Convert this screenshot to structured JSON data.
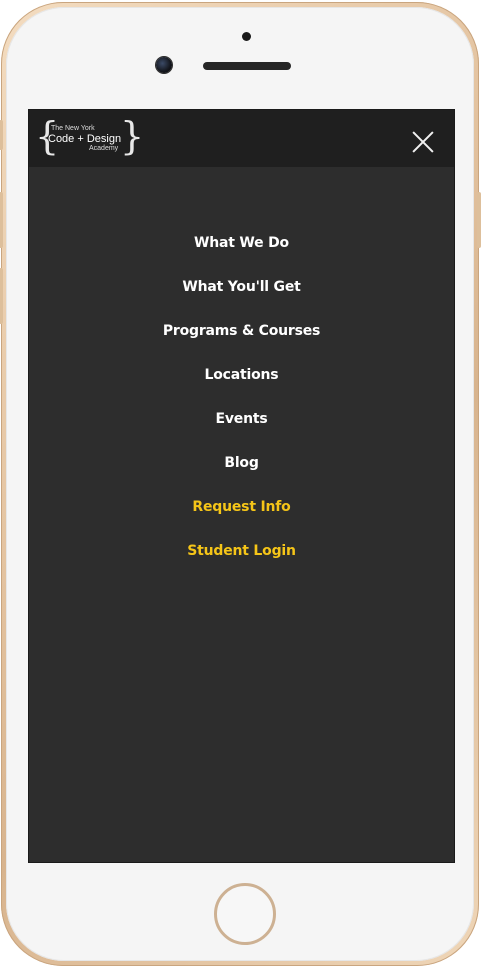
{
  "device": {
    "frame_color": "#e3c3a0",
    "body_color": "#f5f5f5"
  },
  "header": {
    "background": "#1f1f1f",
    "logo": {
      "line1": "The New York",
      "line2": "Code + Design",
      "line3": "Academy"
    },
    "close_icon": "close-icon"
  },
  "menu": {
    "background": "#2d2d2d",
    "text_color": "#ffffff",
    "accent_color": "#f5c518",
    "items": [
      {
        "label": "What We Do",
        "accent": false
      },
      {
        "label": "What You'll Get",
        "accent": false
      },
      {
        "label": "Programs & Courses",
        "accent": false
      },
      {
        "label": "Locations",
        "accent": false
      },
      {
        "label": "Events",
        "accent": false
      },
      {
        "label": "Blog",
        "accent": false
      },
      {
        "label": "Request Info",
        "accent": true
      },
      {
        "label": "Student Login",
        "accent": true
      }
    ]
  }
}
